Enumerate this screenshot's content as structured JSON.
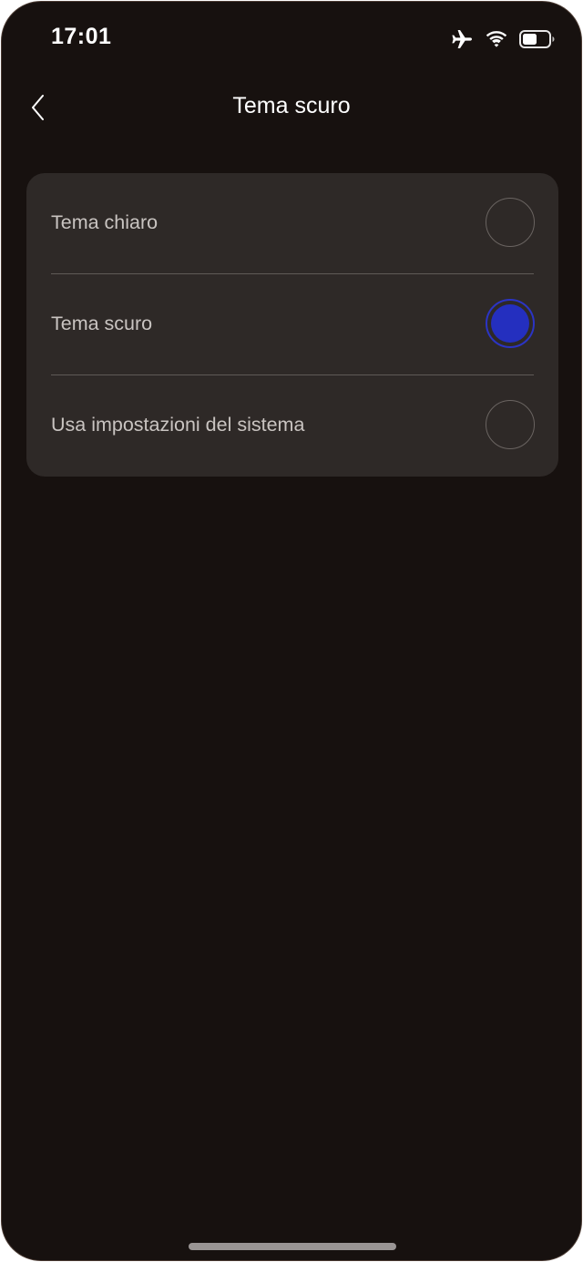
{
  "status_bar": {
    "time": "17:01",
    "icons": [
      "airplane-icon",
      "wifi-icon",
      "battery-icon"
    ]
  },
  "nav": {
    "back_icon": "chevron-left-icon",
    "title": "Tema scuro"
  },
  "options": [
    {
      "label": "Tema chiaro",
      "selected": false
    },
    {
      "label": "Tema scuro",
      "selected": true
    },
    {
      "label": "Usa impostazioni del sistema",
      "selected": false
    }
  ],
  "colors": {
    "background": "#17110f",
    "card": "#2e2927",
    "accent": "#242fbf",
    "text_primary": "#ffffff",
    "text_secondary": "#c9c4c1"
  }
}
